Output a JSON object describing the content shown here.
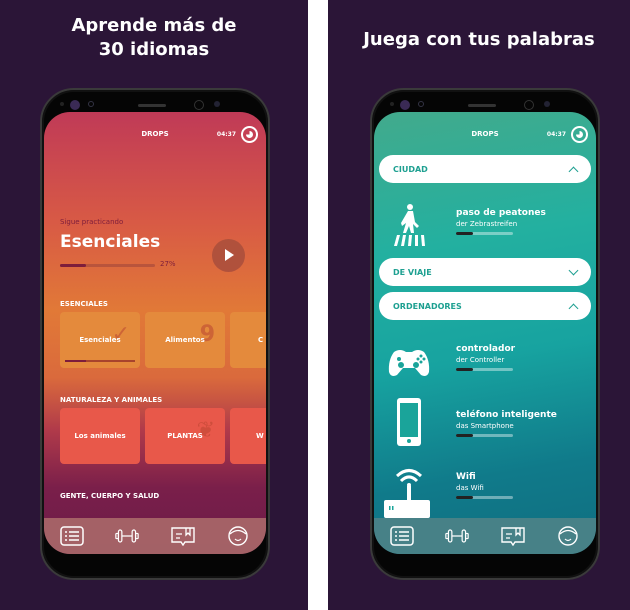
{
  "left_panel": {
    "headline": "Aprende más de 30 idiomas",
    "app": {
      "name": "DROPS",
      "time": "04:37",
      "timer_icon": "timer-icon"
    },
    "continue": {
      "label": "Sigue practicando",
      "title": "Esenciales",
      "progress_percent": 27,
      "progress_text": "27%",
      "play_icon": "play-icon"
    },
    "sections": [
      {
        "title": "ESENCIALES",
        "tiles": [
          {
            "label": "Esenciales",
            "progress": 0.3
          },
          {
            "label": "Alimentos"
          },
          {
            "label": "C"
          }
        ]
      },
      {
        "title": "NATURALEZA Y ANIMALES",
        "tiles": [
          {
            "label": "Los animales"
          },
          {
            "label": "PLANTAS"
          },
          {
            "label": "W"
          }
        ]
      },
      {
        "title": "GENTE, CUERPO Y SALUD"
      }
    ],
    "nav": [
      "list-icon",
      "dumbbell-icon",
      "book-icon",
      "profile-icon"
    ]
  },
  "right_panel": {
    "headline": "Juega con tus palabras",
    "app": {
      "name": "DROPS",
      "time": "04:37",
      "timer_icon": "timer-icon"
    },
    "categories": [
      {
        "label": "CIUDAD",
        "expanded": true
      },
      {
        "label": "DE VIAJE",
        "expanded": false
      },
      {
        "label": "ORDENADORES",
        "expanded": true
      }
    ],
    "words": [
      {
        "word": "paso de peatones",
        "translation": "der Zebrastreifen",
        "icon": "crosswalk-icon",
        "progress": 0.3
      },
      {
        "word": "controlador",
        "translation": "der Controller",
        "icon": "gamepad-icon",
        "progress": 0.3
      },
      {
        "word": "teléfono inteligente",
        "translation": "das Smartphone",
        "icon": "smartphone-icon",
        "progress": 0.3
      },
      {
        "word": "Wifi",
        "translation": "das Wifi",
        "icon": "wifi-router-icon",
        "progress": 0.3
      }
    ],
    "nav": [
      "list-icon",
      "dumbbell-icon",
      "book-icon",
      "profile-icon"
    ]
  },
  "colors": {
    "background": "#2b1537",
    "left_accent": "#e17937",
    "right_accent": "#1ea091",
    "dark_progress": "#7d1d3b"
  }
}
